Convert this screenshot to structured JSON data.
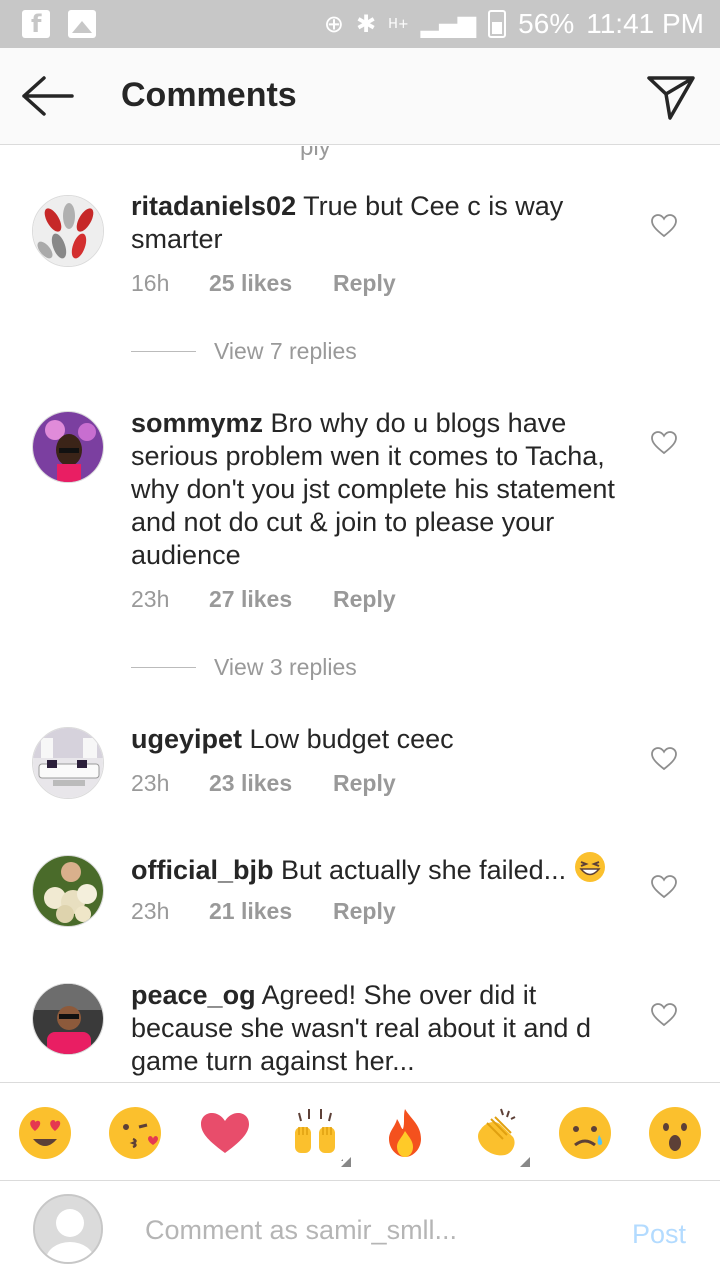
{
  "status_bar": {
    "battery": "56%",
    "time": "11:41 PM",
    "network": "H+"
  },
  "header": {
    "title": "Comments"
  },
  "comments": [
    {
      "username": "ritadaniels02",
      "text": " True but Cee c is way smarter",
      "time": "16h",
      "likes": "25 likes",
      "reply": "Reply",
      "view_replies": "View 7 replies"
    },
    {
      "username": "sommymz",
      "text": " Bro why do u blogs have serious problem wen it comes to Tacha, why don't you jst complete his statement and not do cut & join to please your audience",
      "time": "23h",
      "likes": "27 likes",
      "reply": "Reply",
      "view_replies": "View 3 replies"
    },
    {
      "username": "ugeyipet",
      "text": " Low budget ceec",
      "time": "23h",
      "likes": "23 likes",
      "reply": "Reply"
    },
    {
      "username": "official_bjb",
      "text": " But actually she failed...",
      "time": "23h",
      "likes": "21 likes",
      "reply": "Reply"
    },
    {
      "username": "peace_og",
      "text": " Agreed! She over did it because she wasn't real about it and d game turn against her...",
      "time": "",
      "likes": "",
      "reply": ""
    }
  ],
  "emoji_bar": [
    "heart-eyes",
    "kissing-heart",
    "red-heart",
    "raised-hands",
    "fire",
    "clapping-hands",
    "frowning-tear",
    "surprised"
  ],
  "composer": {
    "placeholder": "Comment as samir_smll...",
    "post_label": "Post"
  },
  "colors": {
    "link_muted": "#999999",
    "post_disabled": "#b3dbff",
    "emoji_yellow": "#fbc02d",
    "heart_red": "#e84d6b"
  }
}
